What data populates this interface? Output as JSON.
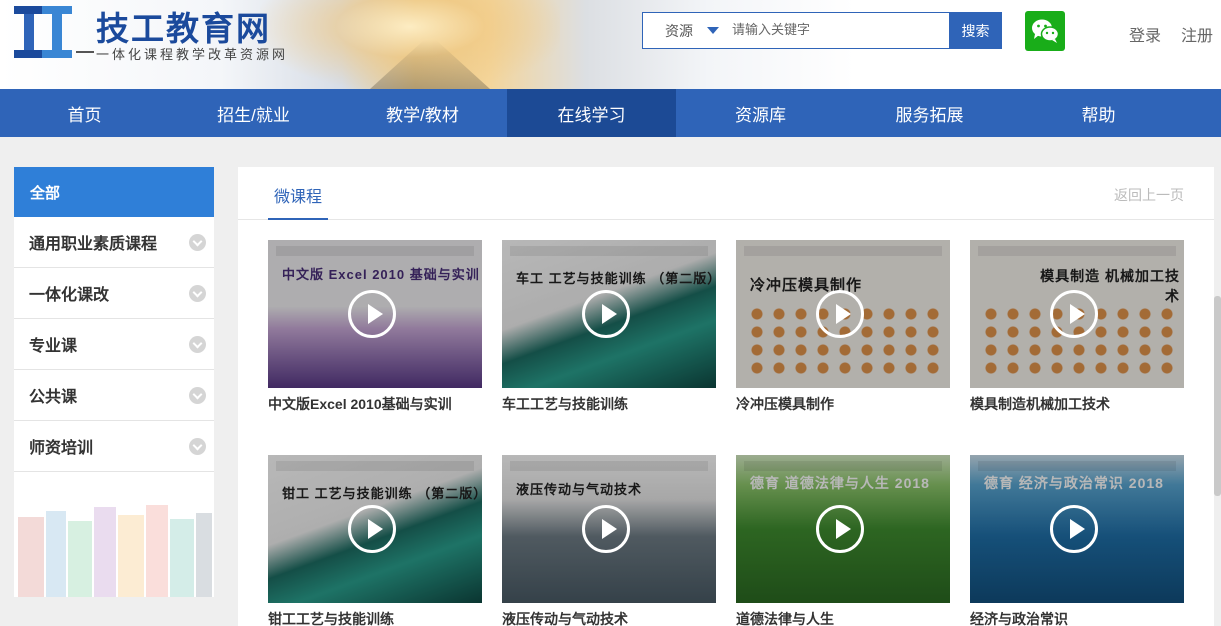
{
  "site": {
    "title": "技工教育网",
    "subtitle": "一体化课程教学改革资源网"
  },
  "search": {
    "scope": "资源",
    "placeholder": "请输入关键字",
    "button": "搜索"
  },
  "user": {
    "login": "登录",
    "register": "注册"
  },
  "nav": {
    "items": [
      {
        "label": "首页"
      },
      {
        "label": "招生/就业"
      },
      {
        "label": "教学/教材"
      },
      {
        "label": "在线学习",
        "active": true
      },
      {
        "label": "资源库"
      },
      {
        "label": "服务拓展"
      },
      {
        "label": "帮助"
      }
    ]
  },
  "sidebar": {
    "all": "全部",
    "items": [
      {
        "label": "通用职业素质课程"
      },
      {
        "label": "一体化课改"
      },
      {
        "label": "专业课"
      },
      {
        "label": "公共课"
      },
      {
        "label": "师资培训"
      }
    ]
  },
  "main": {
    "tab": "微课程",
    "back": "返回上一页",
    "courses": [
      {
        "title": "中文版Excel 2010基础与实训",
        "cover_text": "中文版 Excel 2010 基础与实训"
      },
      {
        "title": "车工工艺与技能训练",
        "cover_text": "车工 工艺与技能训练 （第二版）"
      },
      {
        "title": "冷冲压模具制作",
        "cover_text": "冷冲压模具制作"
      },
      {
        "title": "模具制造机械加工技术",
        "cover_text": "模具制造 机械加工技术"
      },
      {
        "title": "钳工工艺与技能训练",
        "cover_text": "钳工 工艺与技能训练 （第二版）"
      },
      {
        "title": "液压传动与气动技术",
        "cover_text": "液压传动与气动技术"
      },
      {
        "title": "道德法律与人生",
        "cover_text": "德育 道德法律与人生 2018"
      },
      {
        "title": "经济与政治常识",
        "cover_text": "德育 经济与政治常识 2018"
      }
    ]
  },
  "colors": {
    "primary": "#2f64b8",
    "nav_active": "#1c4a95",
    "sidebar_active": "#2f7fd8",
    "wechat": "#19ad19"
  }
}
